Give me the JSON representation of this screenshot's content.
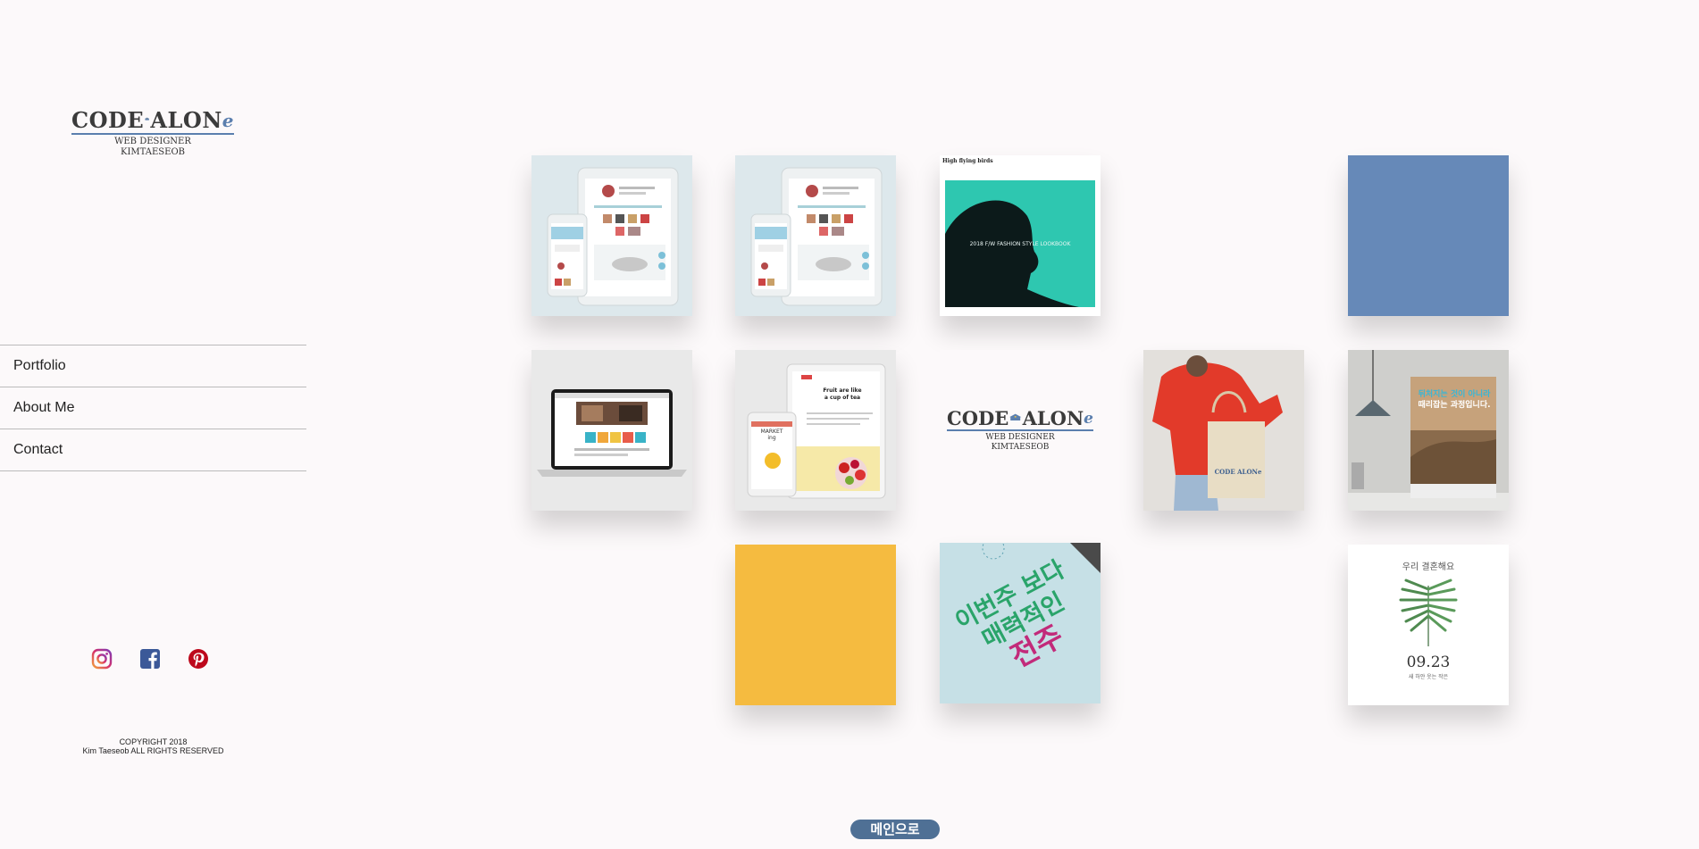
{
  "logo": {
    "word_left": "CODE",
    "word_right": "ALON",
    "word_tail": "e",
    "line1": "WEB DESIGNER",
    "line2": "KIMTAESEOB"
  },
  "nav": {
    "items": [
      {
        "label": "Portfolio"
      },
      {
        "label": "About Me"
      },
      {
        "label": "Contact"
      }
    ]
  },
  "social": [
    "instagram-icon",
    "facebook-icon",
    "pinterest-icon"
  ],
  "footer": {
    "copyright_line1": "COPYRIGHT 2018",
    "copyright_line2": "Kim Taeseob ALL RIGHTS RESERVED"
  },
  "gallery": {
    "fashion_header": "High flying birds",
    "fashion_caption": "2018 F/W FASHION STYLE LOOKBOOK",
    "fruit_title_1": "Fruit are like",
    "fruit_title_2": "a cup of tea",
    "market_label_1": "MARKET",
    "market_label_2": "ing",
    "logo_tile": {
      "word_left": "CODE",
      "word_right": "ALON",
      "word_tail": "e",
      "line1": "WEB DESIGNER",
      "line2": "KIMTAESEOB"
    },
    "bag_logo": "CODE ALONe",
    "poster_line_1": "뒤처지는 것이 아니라",
    "poster_line_2": "때리잡는 과정입니다.",
    "flyer_line_1": "이번주 보다",
    "flyer_line_2": "매력적인",
    "flyer_line_3": "전주",
    "wedding_title": "우리 결혼해요",
    "wedding_date": "09.23",
    "wedding_sub": "새 하얀 웃는 작은"
  },
  "colors": {
    "accent_blue": "#6689b8",
    "accent_yellow": "#f5bb40",
    "button_bg": "#4f7095"
  },
  "main_button": "메인으로"
}
